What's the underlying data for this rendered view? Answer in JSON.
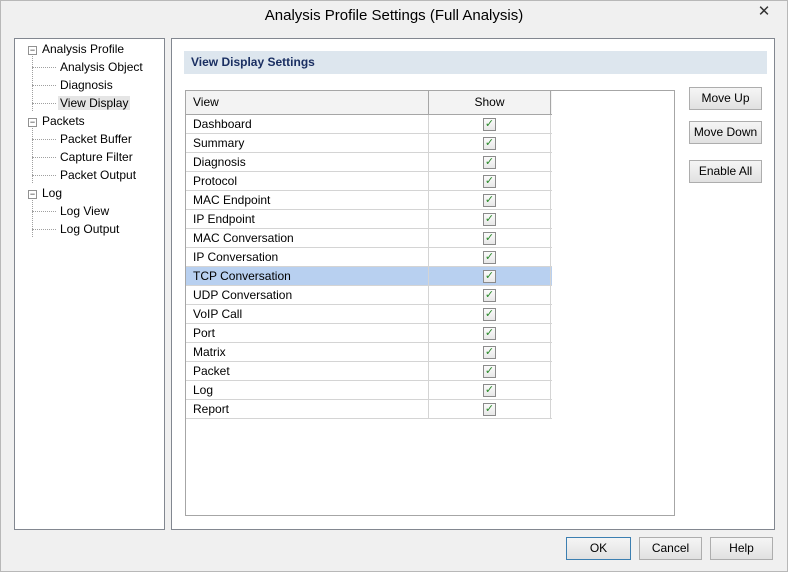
{
  "window": {
    "title": "Analysis Profile Settings (Full Analysis)",
    "close_glyph": "✕"
  },
  "tree": {
    "analysis_profile": {
      "label": "Analysis Profile",
      "expander": "−"
    },
    "analysis_object": "Analysis Object",
    "diagnosis": "Diagnosis",
    "view_display": "View Display",
    "packets": {
      "label": "Packets",
      "expander": "−"
    },
    "packet_buffer": "Packet Buffer",
    "capture_filter": "Capture Filter",
    "packet_output": "Packet Output",
    "log": {
      "label": "Log",
      "expander": "−"
    },
    "log_view": "Log View",
    "log_output": "Log Output"
  },
  "panel": {
    "header": "View Display Settings",
    "columns": {
      "view": "View",
      "show": "Show"
    },
    "rows": [
      {
        "view": "Dashboard",
        "show": "✓"
      },
      {
        "view": "Summary",
        "show": "✓"
      },
      {
        "view": "Diagnosis",
        "show": "✓"
      },
      {
        "view": "Protocol",
        "show": "✓"
      },
      {
        "view": "MAC Endpoint",
        "show": "✓"
      },
      {
        "view": "IP Endpoint",
        "show": "✓"
      },
      {
        "view": "MAC Conversation",
        "show": "✓"
      },
      {
        "view": "IP Conversation",
        "show": "✓"
      },
      {
        "view": "TCP Conversation",
        "show": "✓"
      },
      {
        "view": "UDP Conversation",
        "show": "✓"
      },
      {
        "view": "VoIP Call",
        "show": "✓"
      },
      {
        "view": "Port",
        "show": "✓"
      },
      {
        "view": "Matrix",
        "show": "✓"
      },
      {
        "view": "Packet",
        "show": "✓"
      },
      {
        "view": "Log",
        "show": "✓"
      },
      {
        "view": "Report",
        "show": "✓"
      }
    ]
  },
  "side_buttons": {
    "move_up": "Move Up",
    "move_down": "Move Down",
    "enable_all": "Enable All"
  },
  "footer": {
    "ok": "OK",
    "cancel": "Cancel",
    "help": "Help"
  }
}
